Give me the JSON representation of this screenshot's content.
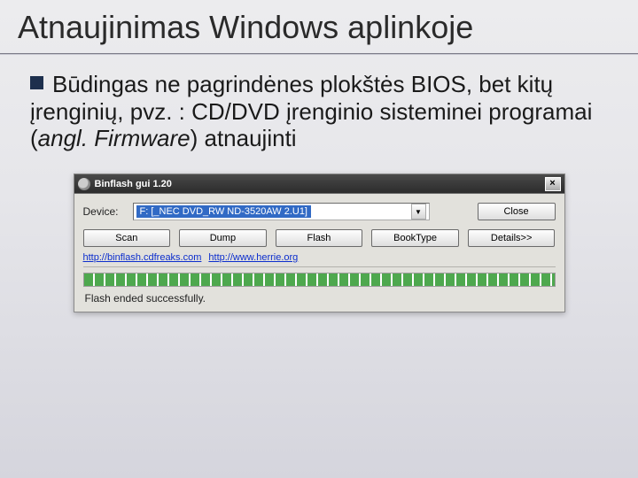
{
  "slide": {
    "title": "Atnaujinimas Windows aplinkoje",
    "body_before_italic": "Būdingas ne pagrindėnes plokštės BIOS, bet kitų įrenginių, pvz. : CD/DVD įrenginio sisteminei programai (",
    "body_italic": "angl. Firmware",
    "body_after_italic": ") atnaujinti"
  },
  "app": {
    "title": "Binflash gui 1.20",
    "close_glyph": "×",
    "device_label": "Device:",
    "device_value": "F: [_NEC   DVD_RW ND-3520AW 2.U1]",
    "close_btn": "Close",
    "buttons": {
      "scan": "Scan",
      "dump": "Dump",
      "flash": "Flash",
      "booktype": "BookType",
      "details": "Details>>"
    },
    "links": {
      "link1": "http://binflash.cdfreaks.com",
      "link2": "http://www.herrie.org"
    },
    "status": "Flash ended successfully."
  }
}
